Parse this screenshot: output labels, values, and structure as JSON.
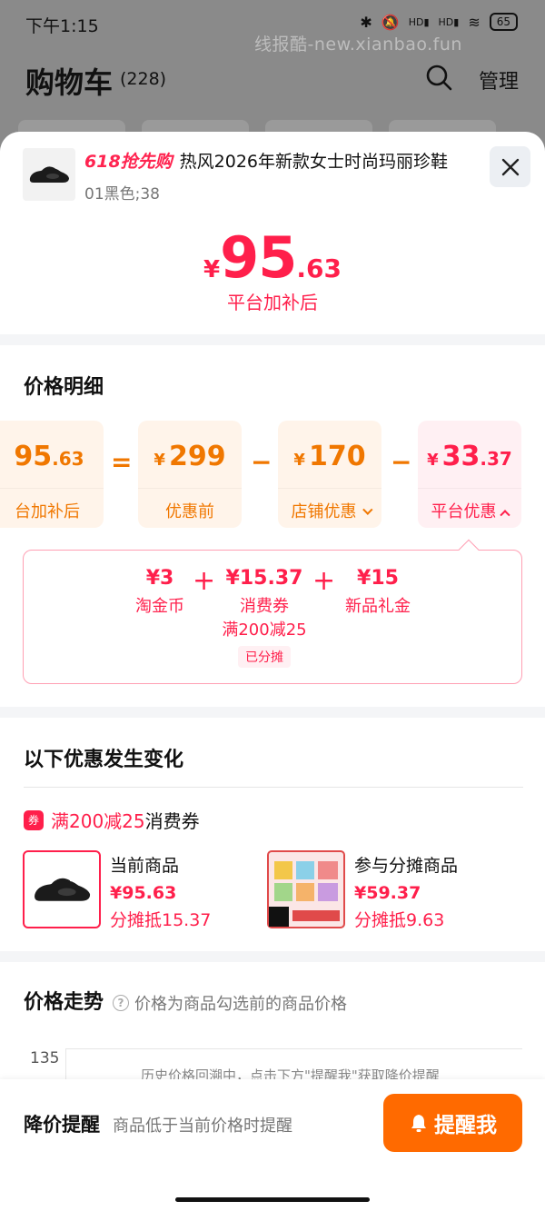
{
  "status": {
    "time": "下午1:15",
    "battery": "65",
    "hd1": "HD",
    "hd2": "HD"
  },
  "watermark": "线报酷-new.xianbao.fun",
  "cart": {
    "title": "购物车",
    "count": "(228)",
    "manage": "管理"
  },
  "product": {
    "promo": "618抢先购",
    "name": "热风2026年新款女士时尚玛丽珍鞋",
    "variant": "01黑色;38",
    "price": {
      "currency": "¥",
      "int": "95",
      "dec": ".63"
    },
    "price_label": "平台加补后"
  },
  "detail": {
    "title": "价格明细",
    "cards": [
      {
        "yen": "",
        "int": "95",
        "dec": ".63",
        "label": "台加补后"
      },
      {
        "yen": "¥",
        "int": "299",
        "dec": "",
        "label": "优惠前"
      },
      {
        "yen": "¥",
        "int": "170",
        "dec": "",
        "label": "店铺优惠"
      },
      {
        "yen": "¥",
        "int": "33",
        "dec": ".37",
        "label": "平台优惠"
      }
    ],
    "ops": [
      "=",
      "−",
      "−"
    ],
    "breakdown": [
      {
        "value": "¥3",
        "name": "淘金币"
      },
      {
        "value": "¥15.37",
        "name": "消费券",
        "sub": "满200减25",
        "tag": "已分摊"
      },
      {
        "value": "¥15",
        "name": "新品礼金"
      }
    ],
    "plus": "+"
  },
  "changes": {
    "title": "以下优惠发生变化",
    "coupon_prefix": "满200减25",
    "coupon_suffix": "消费券",
    "coupon_icon_glyph": "券",
    "items": [
      {
        "title": "当前商品",
        "price": "¥95.63",
        "share": "分摊抵15.37"
      },
      {
        "title": "参与分摊商品",
        "price": "¥59.37",
        "share": "分摊抵9.63"
      }
    ]
  },
  "trend": {
    "title": "价格走势",
    "note": "价格为商品勾选前的商品价格",
    "axis_value": "135",
    "history": "历史价格回溯中，点击下方\"提醒我\"获取降价提醒"
  },
  "reminder": {
    "title": "降价提醒",
    "desc": "商品低于当前价格时提醒",
    "button": "提醒我"
  },
  "colors": {
    "accent_red": "#ff1f4b",
    "accent_orange": "#f07700",
    "button_orange": "#ff6a00"
  }
}
